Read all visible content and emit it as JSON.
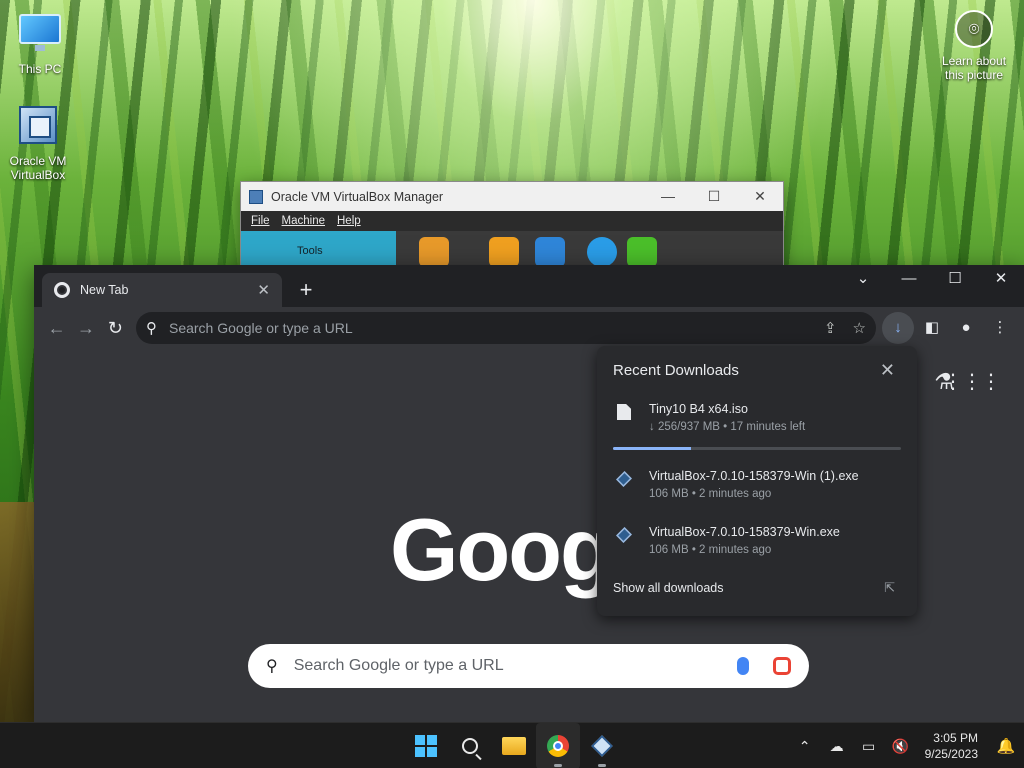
{
  "desktop": {
    "icons": [
      {
        "label": "This PC"
      },
      {
        "label": "Oracle VM VirtualBox"
      }
    ],
    "learn_label": "Learn about this picture"
  },
  "vbox": {
    "title": "Oracle VM VirtualBox Manager",
    "menu": [
      "File",
      "Machine",
      "Help"
    ],
    "tools_label": "Tools"
  },
  "chrome": {
    "tab_title": "New Tab",
    "omnibox_placeholder": "Search Google or type a URL",
    "logo_text": "Goog",
    "search_placeholder": "Search Google or type a URL"
  },
  "downloads": {
    "title": "Recent Downloads",
    "items": [
      {
        "name": "Tiny10 B4 x64.iso",
        "meta": "↓ 256/937 MB • 17 minutes left",
        "progress": 0.27,
        "icon": "file-icon"
      },
      {
        "name": "VirtualBox-7.0.10-158379-Win (1).exe",
        "meta": "106 MB • 2 minutes ago",
        "icon": "virtualbox-icon"
      },
      {
        "name": "VirtualBox-7.0.10-158379-Win.exe",
        "meta": "106 MB • 2 minutes ago",
        "icon": "virtualbox-icon"
      }
    ],
    "show_all": "Show all downloads"
  },
  "taskbar": {
    "time": "3:05 PM",
    "date": "9/25/2023",
    "accent": "#4cc2ff"
  }
}
